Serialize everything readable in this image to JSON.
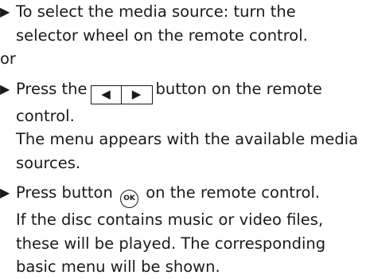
{
  "steps": [
    {
      "bullet": "▶",
      "lines": [
        "To select the media source: turn the",
        "selector wheel on the remote control."
      ]
    },
    {
      "plain": "or"
    },
    {
      "bullet": "▶",
      "pre": "Press the",
      "buttons": [
        "◀",
        "▶"
      ],
      "post": "button on the remote",
      "lines": [
        "control.",
        "The menu appears with the available media",
        "sources."
      ]
    },
    {
      "bullet": "▶",
      "pre": "Press button",
      "ok_label": "OK",
      "post": "on the remote control.",
      "lines": [
        "If the disc contains music or video files,",
        "these will be played. The corresponding",
        "basic menu will be shown."
      ]
    }
  ]
}
